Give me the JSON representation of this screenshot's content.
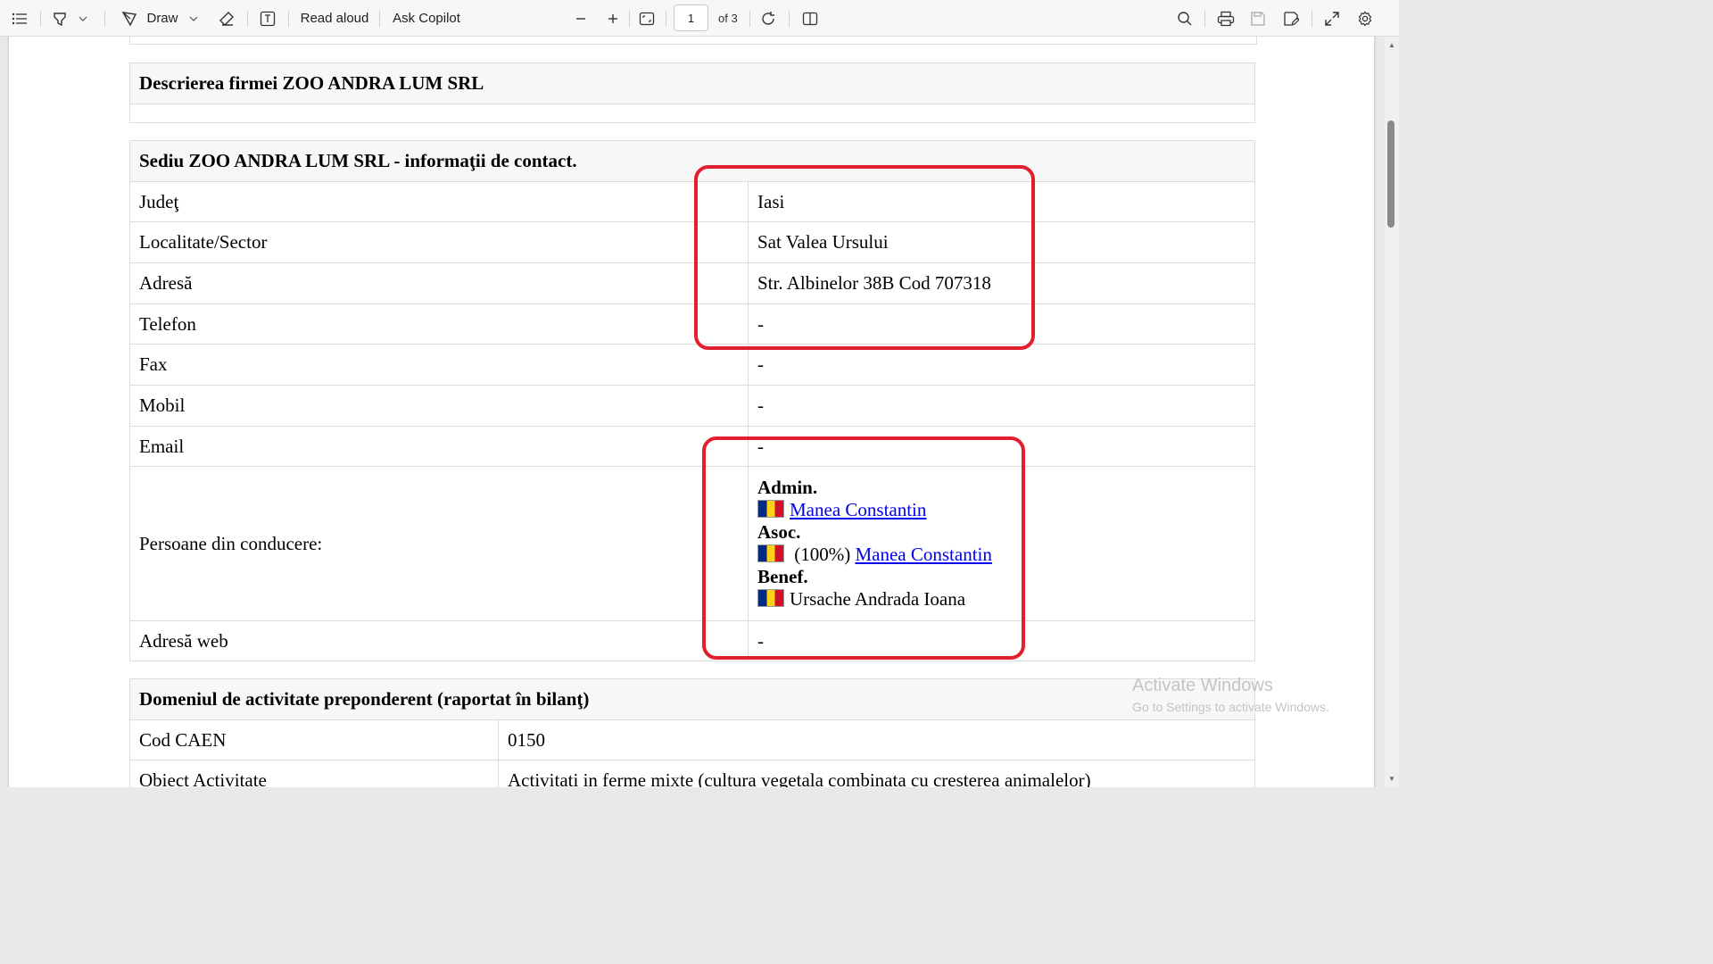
{
  "toolbar": {
    "draw_label": "Draw",
    "read_aloud_label": "Read aloud",
    "ask_copilot_label": "Ask Copilot",
    "page_current": "1",
    "page_total_label": "of 3",
    "icons": [
      "contents-icon",
      "highlight-icon",
      "draw-icon",
      "eraser-icon",
      "text-box-icon",
      "zoom-out-icon",
      "zoom-in-icon",
      "fit-page-icon",
      "rotate-icon",
      "page-view-icon",
      "search-icon",
      "print-icon",
      "save-icon",
      "save-as-icon",
      "fullscreen-icon",
      "settings-icon"
    ]
  },
  "document": {
    "description_header": "Descrierea firmei ZOO ANDRA LUM SRL",
    "contact": {
      "header": "Sediu ZOO ANDRA LUM SRL - informaţii de contact.",
      "rows": [
        {
          "label": "Judeţ",
          "value": "Iasi"
        },
        {
          "label": "Localitate/Sector",
          "value": "Sat Valea Ursului"
        },
        {
          "label": "Adresă",
          "value": "Str. Albinelor 38B Cod 707318"
        },
        {
          "label": "Telefon",
          "value": "-"
        },
        {
          "label": "Fax",
          "value": "-"
        },
        {
          "label": "Mobil",
          "value": "-"
        },
        {
          "label": "Email",
          "value": "-"
        }
      ],
      "management": {
        "label": "Persoane din conducere:",
        "admin_role": "Admin.",
        "admin_name": "Manea Constantin",
        "assoc_role": "Asoc.",
        "assoc_share": "(100%)",
        "assoc_name": "Manea Constantin",
        "benef_role": "Benef.",
        "benef_name": "Ursache Andrada Ioana"
      },
      "web": {
        "label": "Adresă web",
        "value": "-"
      }
    },
    "activity": {
      "header": "Domeniul de activitate preponderent (raportat în bilanţ)",
      "rows": [
        {
          "label": "Cod CAEN",
          "value": "0150"
        },
        {
          "label": "Obiect Activitate",
          "value": "Activitati in ferme mixte (cultura vegetala combinata cu cresterea animalelor)"
        }
      ]
    }
  },
  "watermark": {
    "line1": "Activate Windows",
    "line2": "Go to Settings to activate Windows."
  },
  "colors": {
    "highlight_box": "#e0202e",
    "link": "#0000ee"
  }
}
